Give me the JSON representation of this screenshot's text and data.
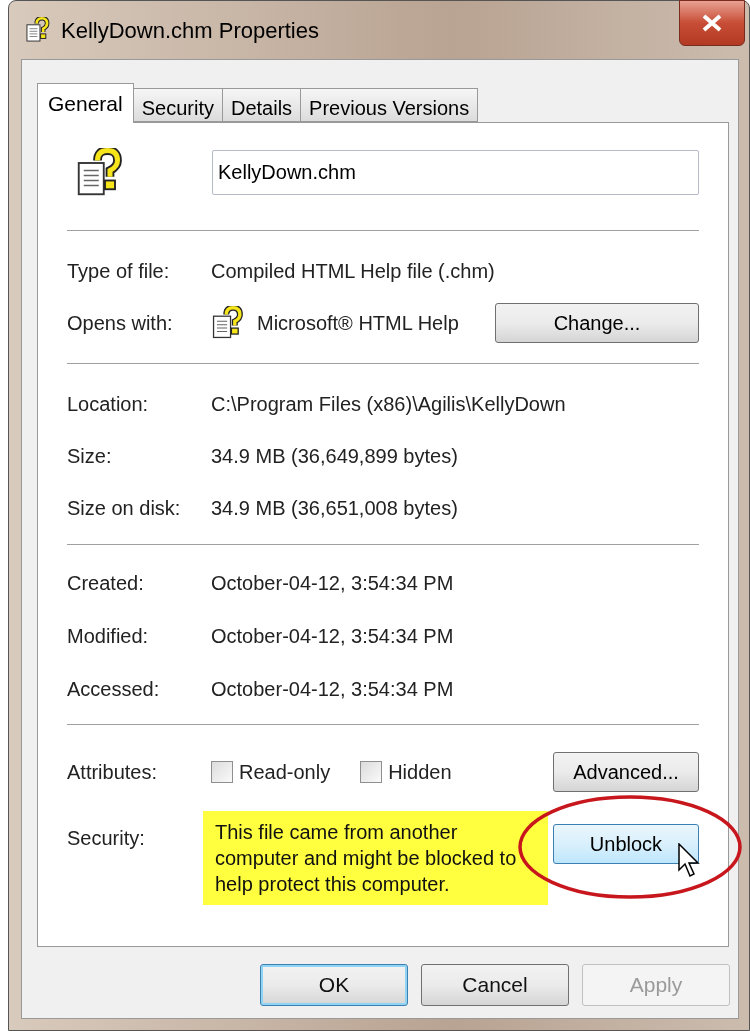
{
  "window": {
    "title": "KellyDown.chm Properties"
  },
  "tabs": [
    {
      "label": "General",
      "selected": true
    },
    {
      "label": "Security",
      "selected": false
    },
    {
      "label": "Details",
      "selected": false
    },
    {
      "label": "Previous Versions",
      "selected": false
    }
  ],
  "file_name": {
    "value": "KellyDown.chm"
  },
  "type_of_file": {
    "label": "Type of file:",
    "value": "Compiled HTML Help file (.chm)"
  },
  "opens_with": {
    "label": "Opens with:",
    "value": "Microsoft® HTML Help",
    "button": "Change..."
  },
  "location_rows": [
    {
      "label": "Location:",
      "value": "C:\\Program Files (x86)\\Agilis\\KellyDown"
    },
    {
      "label": "Size:",
      "value": "34.9 MB (36,649,899 bytes)"
    },
    {
      "label": "Size on disk:",
      "value": "34.9 MB (36,651,008 bytes)"
    }
  ],
  "date_rows": [
    {
      "label": "Created:",
      "value": "October-04-12, 3:54:34 PM"
    },
    {
      "label": "Modified:",
      "value": "October-04-12, 3:54:34 PM"
    },
    {
      "label": "Accessed:",
      "value": "October-04-12, 3:54:34 PM"
    }
  ],
  "attributes": {
    "label": "Attributes:",
    "options": [
      {
        "label": "Read-only",
        "checked": false
      },
      {
        "label": "Hidden",
        "checked": false
      }
    ],
    "button": "Advanced..."
  },
  "security": {
    "label": "Security:",
    "message": "This file came from another computer and might be blocked to help protect this computer.",
    "button": "Unblock",
    "highlighted": true,
    "circled": true
  },
  "buttons": [
    {
      "label": "OK",
      "default": true,
      "disabled": false
    },
    {
      "label": "Cancel",
      "default": false,
      "disabled": false
    },
    {
      "label": "Apply",
      "default": false,
      "disabled": true
    }
  ]
}
